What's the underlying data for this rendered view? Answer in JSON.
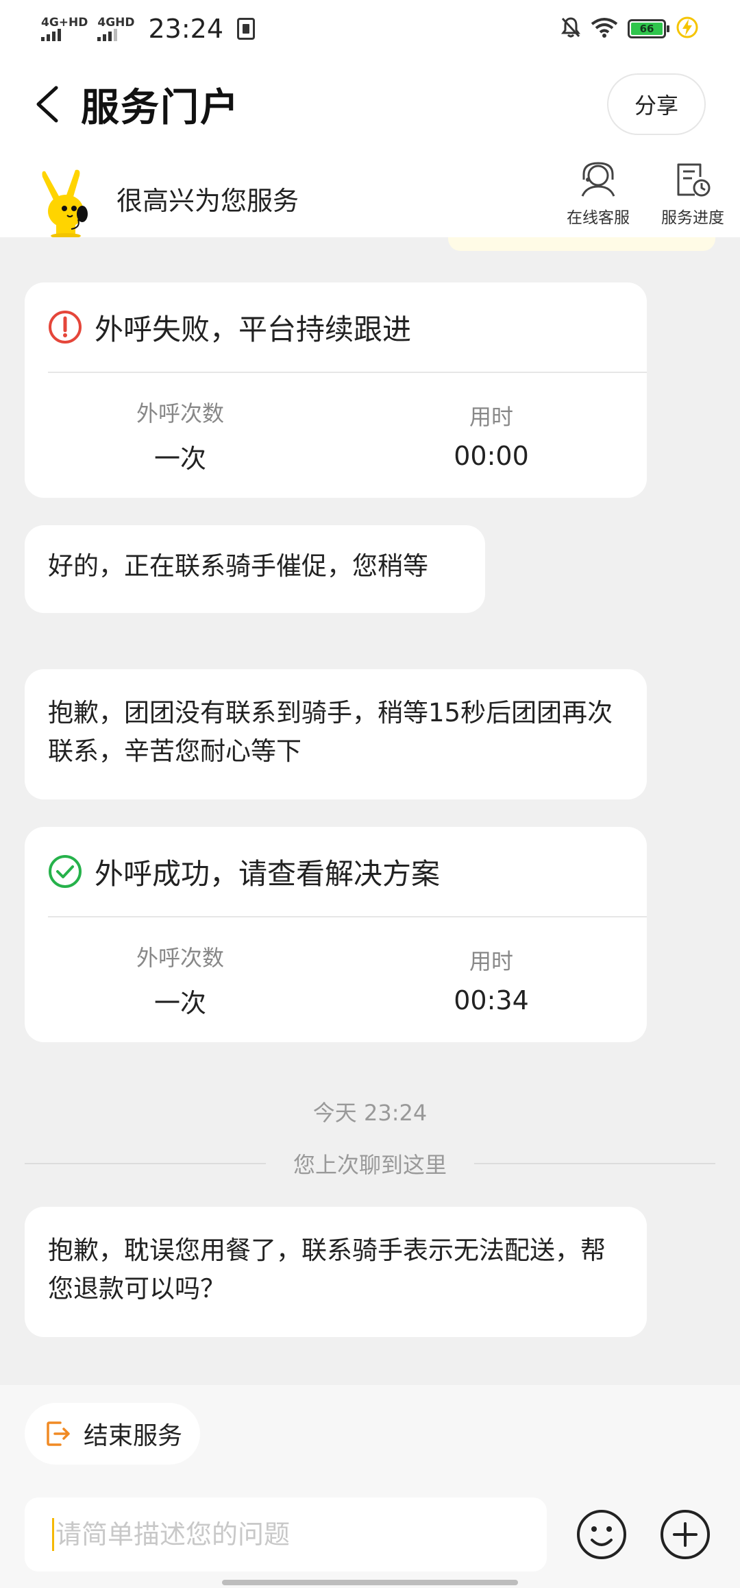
{
  "status_bar": {
    "network1": "4G+HD",
    "network2": "4GHD",
    "time": "23:24",
    "battery": "66"
  },
  "header": {
    "title": "服务门户",
    "share": "分享"
  },
  "agent": {
    "greeting": "很高兴为您服务",
    "online_service": "在线客服",
    "service_progress": "服务进度"
  },
  "messages": {
    "call_fail": {
      "title": "外呼失败，平台持续跟进",
      "count_label": "外呼次数",
      "count_value": "一次",
      "time_label": "用时",
      "time_value": "00:00"
    },
    "msg1": "好的，正在联系骑手催促，您稍等",
    "msg2": "抱歉，团团没有联系到骑手，稍等15秒后团团再次联系，辛苦您耐心等下",
    "call_success": {
      "title": "外呼成功，请查看解决方案",
      "count_label": "外呼次数",
      "count_value": "一次",
      "time_label": "用时",
      "time_value": "00:34"
    },
    "timestamp": "今天 23:24",
    "divider": "您上次聊到这里",
    "msg3": "抱歉，耽误您用餐了，联系骑手表示无法配送，帮您退款可以吗？"
  },
  "bottom": {
    "end_service": "结束服务",
    "input_placeholder": "请简单描述您的问题"
  },
  "colors": {
    "error": "#e5463a",
    "success": "#26b24b",
    "accent": "#f5b800",
    "end_icon": "#f08a24"
  }
}
